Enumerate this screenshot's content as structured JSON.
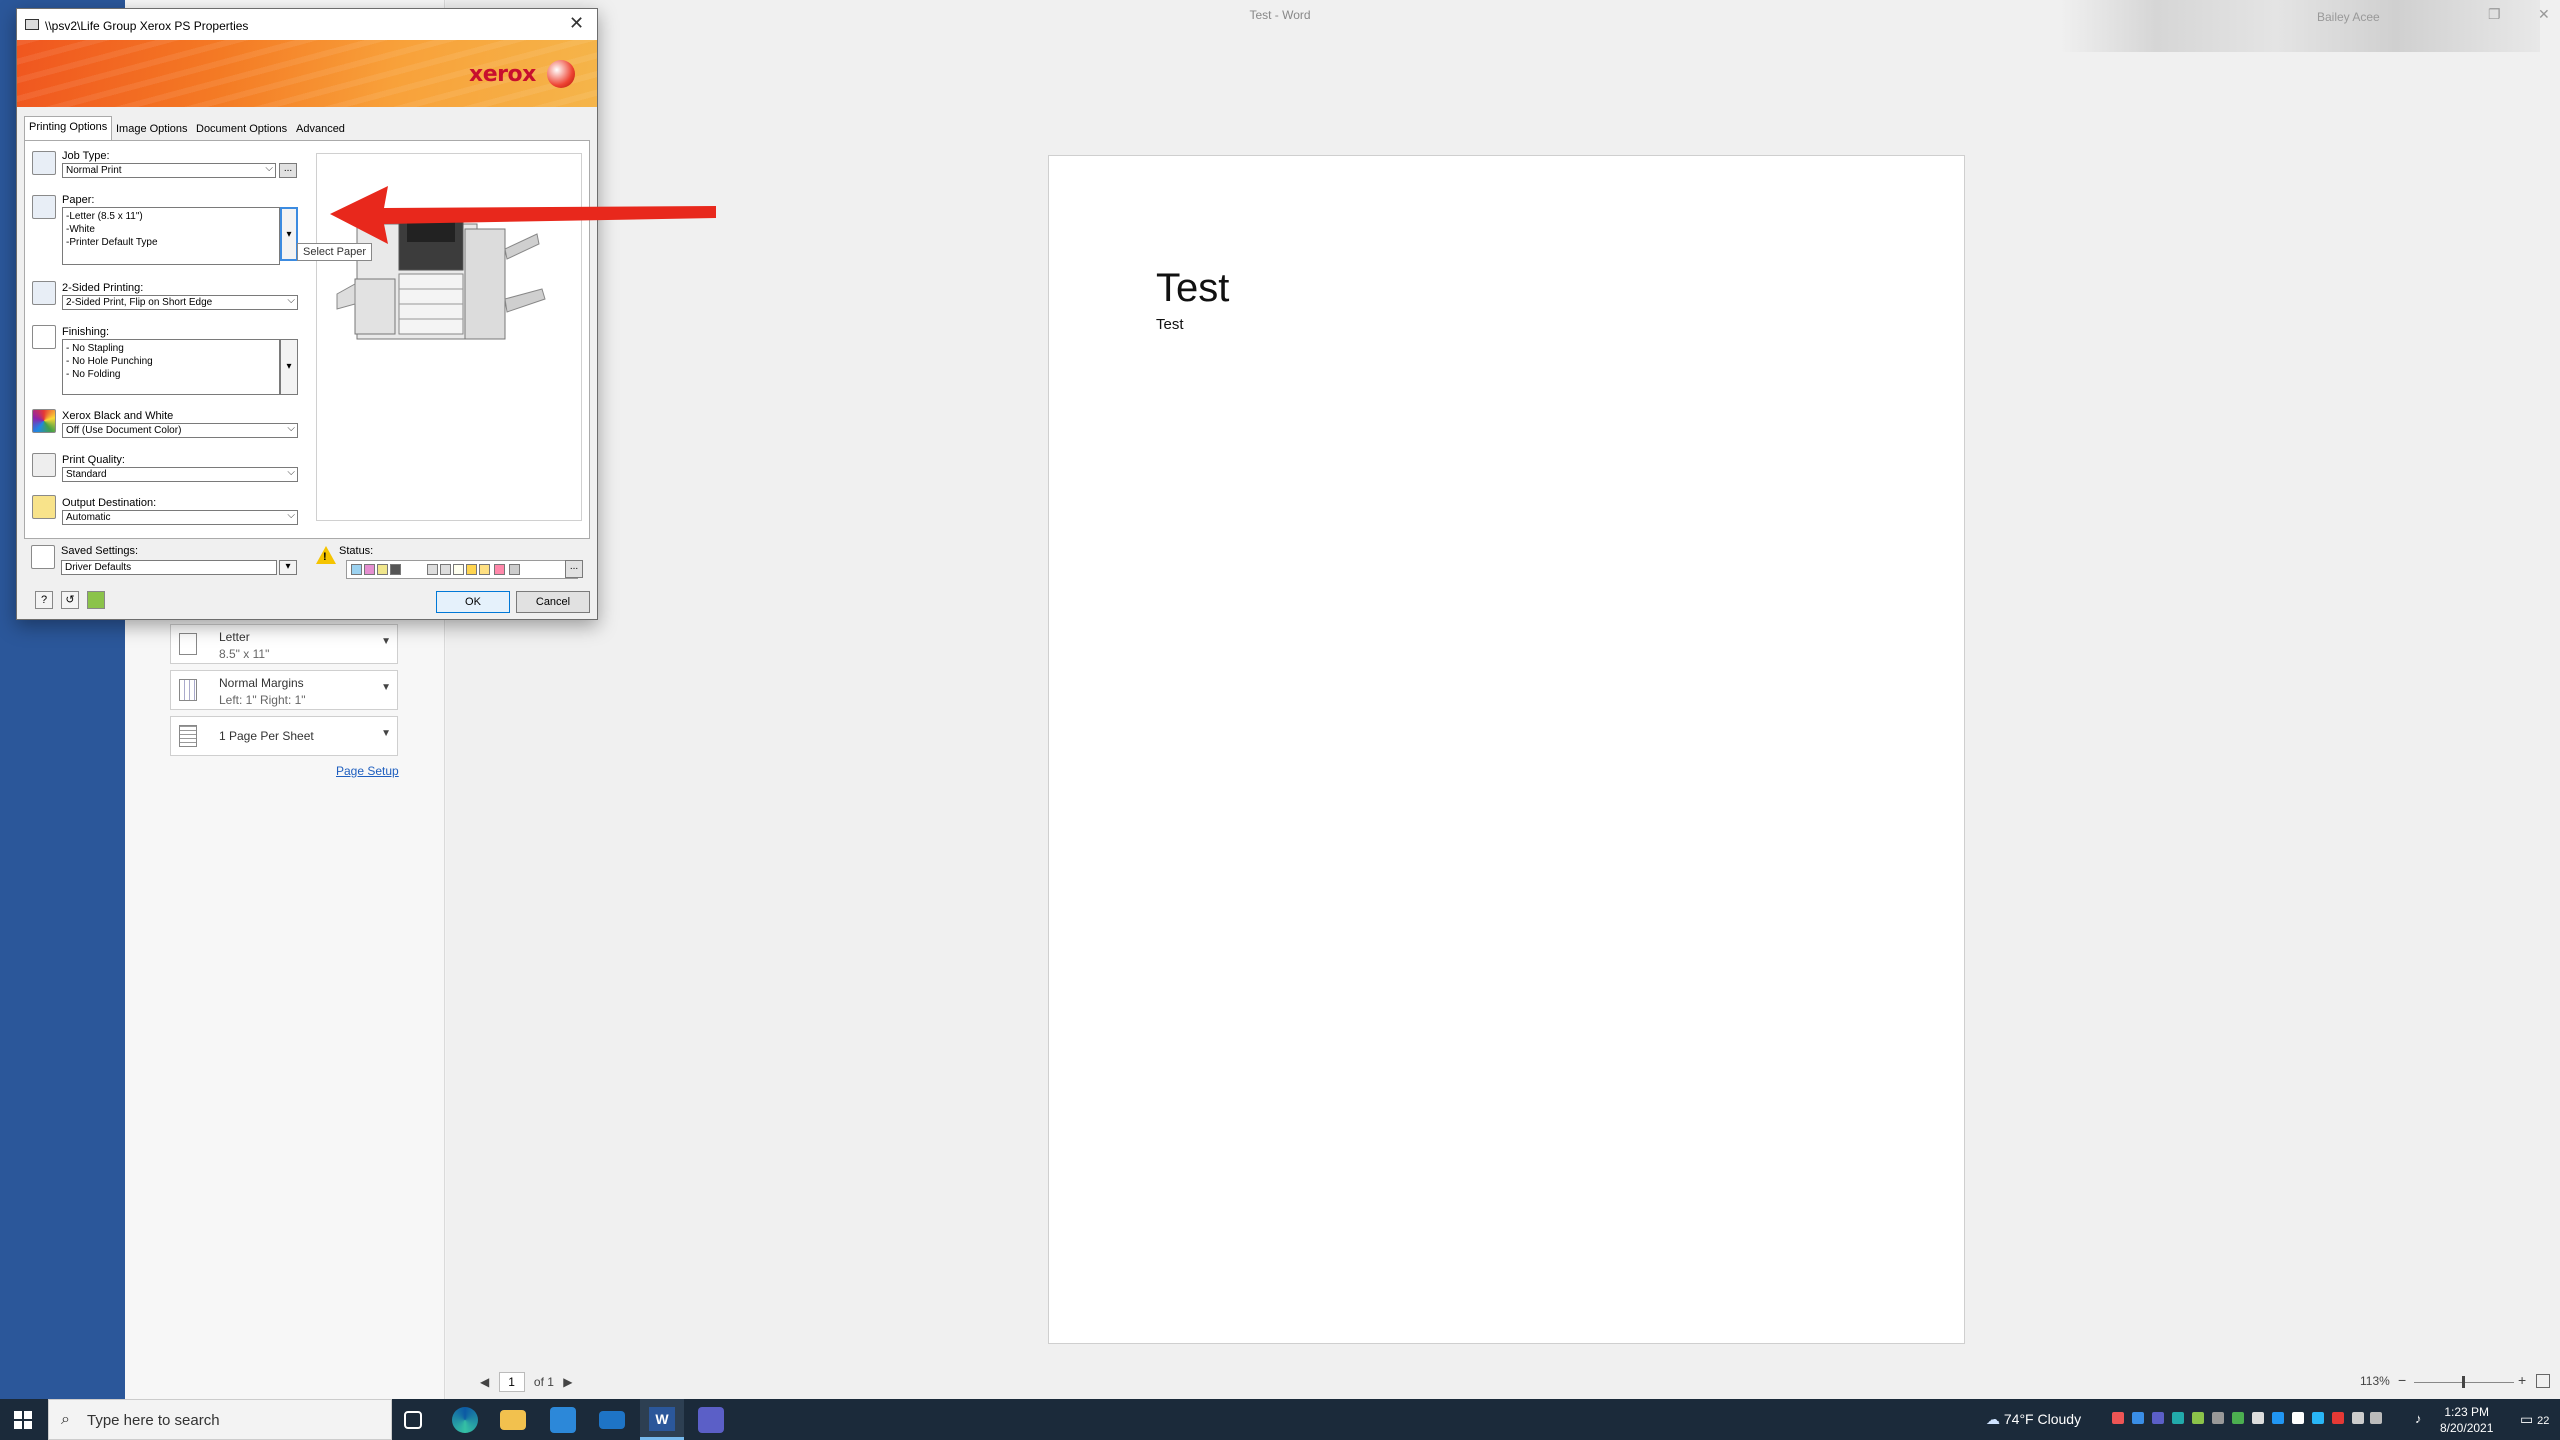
{
  "word": {
    "title": "Test - Word",
    "account": "Bailey Acee",
    "doc_heading": "Test",
    "doc_text": "Test",
    "page_size": {
      "title": "Letter",
      "subtitle": "8.5\" x 11\""
    },
    "margins": {
      "title": "Normal Margins",
      "subtitle": "Left:  1\"    Right:  1\""
    },
    "pages_per_sheet": {
      "title": "1 Page Per Sheet"
    },
    "page_setup_link": "Page Setup",
    "page_number": "1",
    "page_of": "of 1",
    "zoom": "113%"
  },
  "dialog": {
    "title": "\\\\psv2\\Life Group Xerox PS Properties",
    "logo": "xerox",
    "tabs": [
      "Printing Options",
      "Image Options",
      "Document Options",
      "Advanced"
    ],
    "job_type": {
      "label": "Job Type:",
      "value": "Normal Print"
    },
    "paper": {
      "label": "Paper:",
      "lines": [
        "-Letter (8.5 x 11\")",
        "-White",
        "-Printer Default Type"
      ],
      "tooltip": "Select Paper"
    },
    "two_sided": {
      "label": "2-Sided Printing:",
      "value": "2-Sided Print, Flip on Short Edge"
    },
    "finishing": {
      "label": "Finishing:",
      "lines": [
        "- No Stapling",
        "- No Hole Punching",
        "- No Folding"
      ]
    },
    "bw": {
      "label": "Xerox Black and White",
      "value": "Off (Use Document Color)"
    },
    "quality": {
      "label": "Print Quality:",
      "value": "Standard"
    },
    "output": {
      "label": "Output Destination:",
      "value": "Automatic"
    },
    "saved": {
      "label": "Saved Settings:",
      "value": "Driver Defaults"
    },
    "status": {
      "label": "Status:"
    },
    "ok": "OK",
    "cancel": "Cancel",
    "help": "?",
    "ellipsis": "..."
  },
  "taskbar": {
    "search_placeholder": "Type here to search",
    "weather": "74°F  Cloudy",
    "time": "1:23 PM",
    "date": "8/20/2021",
    "notifications": "22"
  },
  "colors": {
    "word_blue": "#2b579a",
    "xerox_red": "#c8102e",
    "annotation_arrow": "#e8281c"
  }
}
